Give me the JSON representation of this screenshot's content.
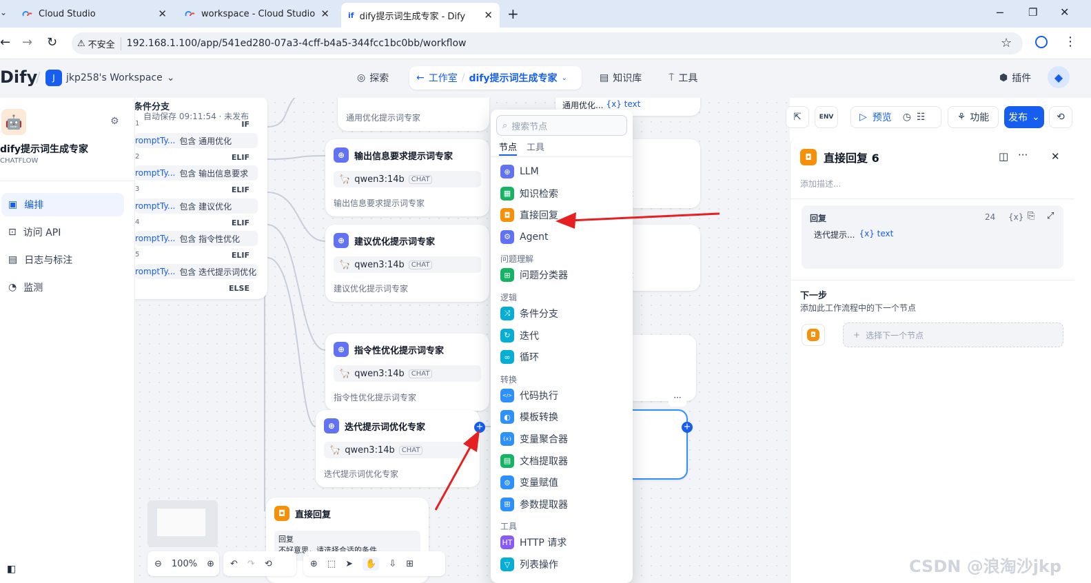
{
  "browser": {
    "tabs": [
      {
        "label": "Cloud Studio"
      },
      {
        "label": "workspace - Cloud Studio"
      },
      {
        "label": "dify提示词生成专家 - Dify"
      }
    ],
    "new_tab": "+",
    "not_secure": "不安全",
    "url": "192.168.1.100/app/541ed280-07a3-4cff-b4a5-344fcc1bc0bb/workflow"
  },
  "header": {
    "logo": "Dify",
    "workspace_initial": "J",
    "workspace": "jkp258's Workspace",
    "nav": {
      "explore": "探索",
      "studio": "工作室",
      "app_name": "dify提示词生成专家",
      "knowledge": "知识库",
      "tools": "工具",
      "plugins": "插件"
    }
  },
  "sidebar": {
    "app_name": "dify提示词生成专家",
    "app_type": "CHATFLOW",
    "menu": [
      "编排",
      "访问 API",
      "日志与标注",
      "监测"
    ]
  },
  "canvas": {
    "if_node": {
      "title": "条件分支",
      "autosave": "自动保存 09:11:54 · 未发布",
      "branches": [
        {
          "num": "1",
          "label": "IF",
          "cond_var": "romptTy...",
          "cond_text": "包含 通用优化"
        },
        {
          "num": "2",
          "label": "ELIF",
          "cond_var": "romptTy...",
          "cond_text": "包含 输出信息要求"
        },
        {
          "num": "3",
          "label": "ELIF",
          "cond_var": "romptTy...",
          "cond_text": "包含 建议优化"
        },
        {
          "num": "4",
          "label": "ELIF",
          "cond_var": "romptTy...",
          "cond_text": "包含 指令性优化"
        },
        {
          "num": "5",
          "label": "ELIF",
          "cond_var": "romptTy...",
          "cond_text": "包含 迭代提示词优化"
        }
      ],
      "else": "ELSE"
    },
    "top_partial_desc": "通用优化提示词专家",
    "top_right_partial": "通用优化...",
    "top_right_var": "{x} text",
    "llm_nodes": [
      {
        "title": "输出信息要求提示词专家",
        "model": "qwen3:14b",
        "chat": "CHAT",
        "desc": "输出信息要求提示词专家"
      },
      {
        "title": "建议优化提示词专家",
        "model": "qwen3:14b",
        "chat": "CHAT",
        "desc": "建议优化提示词专家"
      },
      {
        "title": "指令性优化提示词专家",
        "model": "qwen3:14b",
        "chat": "CHAT",
        "desc": "指令性优化提示词专家"
      },
      {
        "title": "迭代提示词优化专家",
        "model": "qwen3:14b",
        "chat": "CHAT",
        "desc": "迭代提示词优化专家"
      }
    ],
    "answer_node": {
      "title": "直接回复",
      "label": "回复",
      "text": "不好意思，请选择合适的条件"
    },
    "hidden_text_1": "t",
    "hidden_text_2": "t",
    "zoom": "100%"
  },
  "picker": {
    "search_placeholder": "搜索节点",
    "tabs": [
      "节点",
      "工具"
    ],
    "items": [
      {
        "group": "",
        "label": "LLM",
        "color": "#6172f3"
      },
      {
        "group": "",
        "label": "知识检索",
        "color": "#16b364"
      },
      {
        "group": "",
        "label": "直接回复",
        "color": "#f79009"
      },
      {
        "group": "",
        "label": "Agent",
        "color": "#6172f3"
      },
      {
        "group": "问题理解",
        "label": "问题分类器",
        "color": "#16b364"
      },
      {
        "group": "逻辑",
        "label": "条件分支",
        "color": "#06aed4"
      },
      {
        "group": "",
        "label": "迭代",
        "color": "#06aed4"
      },
      {
        "group": "",
        "label": "循环",
        "color": "#06aed4"
      },
      {
        "group": "转换",
        "label": "代码执行",
        "color": "#2e90fa"
      },
      {
        "group": "",
        "label": "模板转换",
        "color": "#2e90fa"
      },
      {
        "group": "",
        "label": "变量聚合器",
        "color": "#2e90fa"
      },
      {
        "group": "",
        "label": "文档提取器",
        "color": "#16b364"
      },
      {
        "group": "",
        "label": "变量赋值",
        "color": "#2e90fa"
      },
      {
        "group": "",
        "label": "参数提取器",
        "color": "#2e90fa"
      },
      {
        "group": "工具",
        "label": "HTTP 请求",
        "color": "#875bf7"
      },
      {
        "group": "",
        "label": "列表操作",
        "color": "#06aed4"
      }
    ]
  },
  "toolbar": {
    "preview": "预览",
    "features": "功能",
    "publish": "发布",
    "env": "ENV"
  },
  "panel": {
    "title": "直接回复 6",
    "desc_placeholder": "添加描述...",
    "reply_label": "回复",
    "count": "24",
    "var_token": "{x}",
    "ref_node": "迭代提示...",
    "ref_var": "{x} text",
    "next_step": "下一步",
    "next_hint": "添加此工作流程中的下一个节点",
    "choose_next": "选择下一个节点"
  },
  "watermark": "CSDN @浪淘沙jkp"
}
